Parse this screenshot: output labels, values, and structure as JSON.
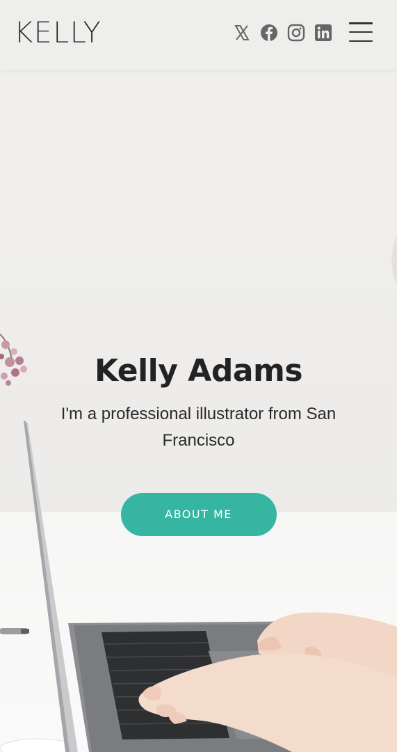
{
  "header": {
    "logo": "KELLY",
    "socials": [
      {
        "name": "x-icon"
      },
      {
        "name": "facebook-icon"
      },
      {
        "name": "instagram-icon"
      },
      {
        "name": "linkedin-icon"
      }
    ],
    "menu_icon": "hamburger-menu-icon"
  },
  "hero": {
    "title": "Kelly Adams",
    "subtitle": "I'm a professional illustrator from San Francisco",
    "button_label": "ABOUT ME"
  },
  "colors": {
    "accent": "#36b5a2",
    "header_bg": "#eeeeec",
    "text": "#222222",
    "icon": "#666666"
  }
}
